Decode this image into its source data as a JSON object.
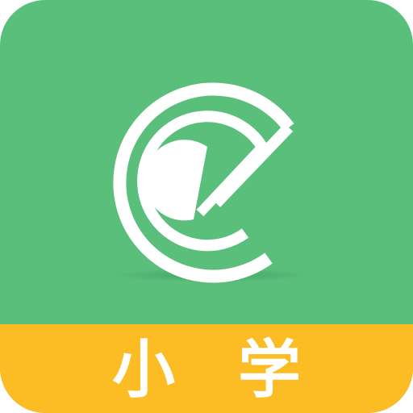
{
  "app_icon": {
    "label": "小学",
    "colors": {
      "background": "#5bbf7c",
      "banner": "#fcbd24",
      "logo": "#ffffff",
      "label": "#ffffff"
    },
    "logo_icon": "letter-e-icon"
  }
}
